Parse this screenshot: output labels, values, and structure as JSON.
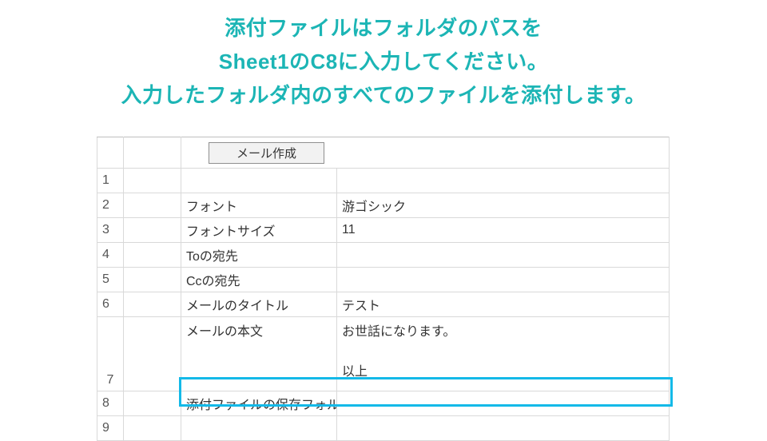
{
  "headline": {
    "line1": "添付ファイルはフォルダのパスを",
    "line2": "Sheet1のC8に入力してください。",
    "line3": "入力したフォルダ内のすべてのファイルを添付します。"
  },
  "button": {
    "label": "メール作成"
  },
  "rows": {
    "r1": "1",
    "r2": "2",
    "r3": "3",
    "r4": "4",
    "r5": "5",
    "r6": "6",
    "r7": "7",
    "r8": "8",
    "r9": "9"
  },
  "cells": {
    "b2": "フォント",
    "c2": "游ゴシック",
    "b3": "フォントサイズ",
    "c3": "11",
    "b4": "Toの宛先",
    "c4": "",
    "b5": "Ccの宛先",
    "c5": "",
    "b6": "メールのタイトル",
    "c6": "テスト",
    "b7": "メールの本文",
    "c7_top": "お世話になります。",
    "c7_bottom": "以上",
    "b8": "添付ファイルの保存フォルダ",
    "c8": "",
    "b9": "",
    "c9": ""
  },
  "colors": {
    "headline": "#1cb5b5",
    "highlight": "#13b9e8",
    "grid": "#d9d9d9"
  }
}
